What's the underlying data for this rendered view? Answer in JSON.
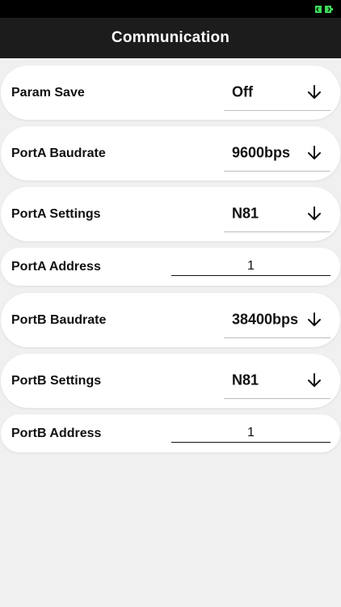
{
  "status_bar": {
    "battery_icon": "battery-charging-icon",
    "battery_color": "#3ddc5a"
  },
  "header": {
    "title": "Communication"
  },
  "rows": [
    {
      "label": "Param Save",
      "kind": "picker",
      "value": "Off",
      "icon": "arrow-down-icon"
    },
    {
      "label": "PortA Baudrate",
      "kind": "picker",
      "value": "9600bps",
      "icon": "arrow-down-icon"
    },
    {
      "label": "PortA Settings",
      "kind": "picker",
      "value": "N81",
      "icon": "arrow-down-icon"
    },
    {
      "label": "PortA Address",
      "kind": "input",
      "value": "1"
    },
    {
      "label": "PortB Baudrate",
      "kind": "picker",
      "value": "38400bps",
      "icon": "arrow-down-icon"
    },
    {
      "label": "PortB Settings",
      "kind": "picker",
      "value": "N81",
      "icon": "arrow-down-icon"
    },
    {
      "label": "PortB Address",
      "kind": "input",
      "value": "1"
    }
  ],
  "colors": {
    "background": "#f0f0f0",
    "card": "#ffffff",
    "nav_bar": "#1c1c1c",
    "text": "#111111"
  }
}
